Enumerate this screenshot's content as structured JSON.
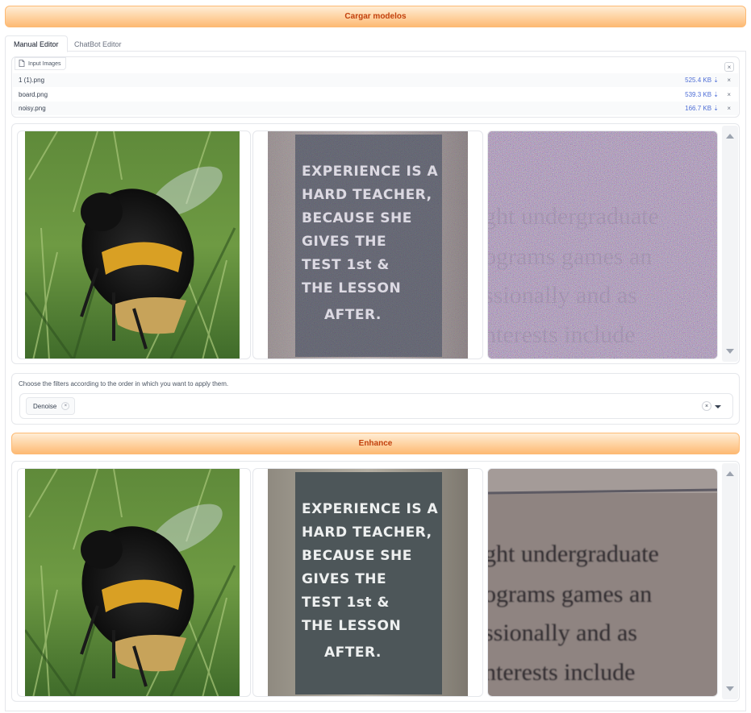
{
  "load_button": "Cargar modelos",
  "tabs": [
    {
      "label": "Manual Editor",
      "active": true
    },
    {
      "label": "ChatBot Editor",
      "active": false
    }
  ],
  "input_files": {
    "label": "Input Images",
    "clear_symbol": "×",
    "files": [
      {
        "name": "1 (1).png",
        "size": "525.4 KB ⇣",
        "remove": "×"
      },
      {
        "name": "board.png",
        "size": "539.3 KB ⇣",
        "remove": "×"
      },
      {
        "name": "noisy.png",
        "size": "166.7 KB ⇣",
        "remove": "×"
      }
    ]
  },
  "input_gallery": {
    "images": [
      "bee-photo",
      "chalkboard-photo",
      "noisy-text-photo"
    ],
    "chalkboard_lines": [
      "EXPERIENCE IS A",
      "HARD TEACHER,",
      "BECAUSE SHE",
      "GIVES THE",
      "TEST 1st &",
      "THE LESSON",
      "AFTER."
    ],
    "text_lines": [
      "ght undergraduate",
      "ograms games an",
      "ssionally and as",
      "nterests include"
    ]
  },
  "filters": {
    "label": "Choose the filters according to the order in which you want to apply them.",
    "selected": [
      "Denoise"
    ],
    "chip_remove": "×",
    "clear_symbol": "×"
  },
  "enhance_button": "Enhance",
  "output_gallery": {
    "images": [
      "bee-enhanced",
      "chalkboard-enhanced",
      "text-denoised"
    ]
  },
  "colors": {
    "accent_text": "#c2410c",
    "button_gradient_top": "#ffedd5",
    "button_gradient_bottom": "#fdba74",
    "file_size": "#4f6fd6"
  }
}
